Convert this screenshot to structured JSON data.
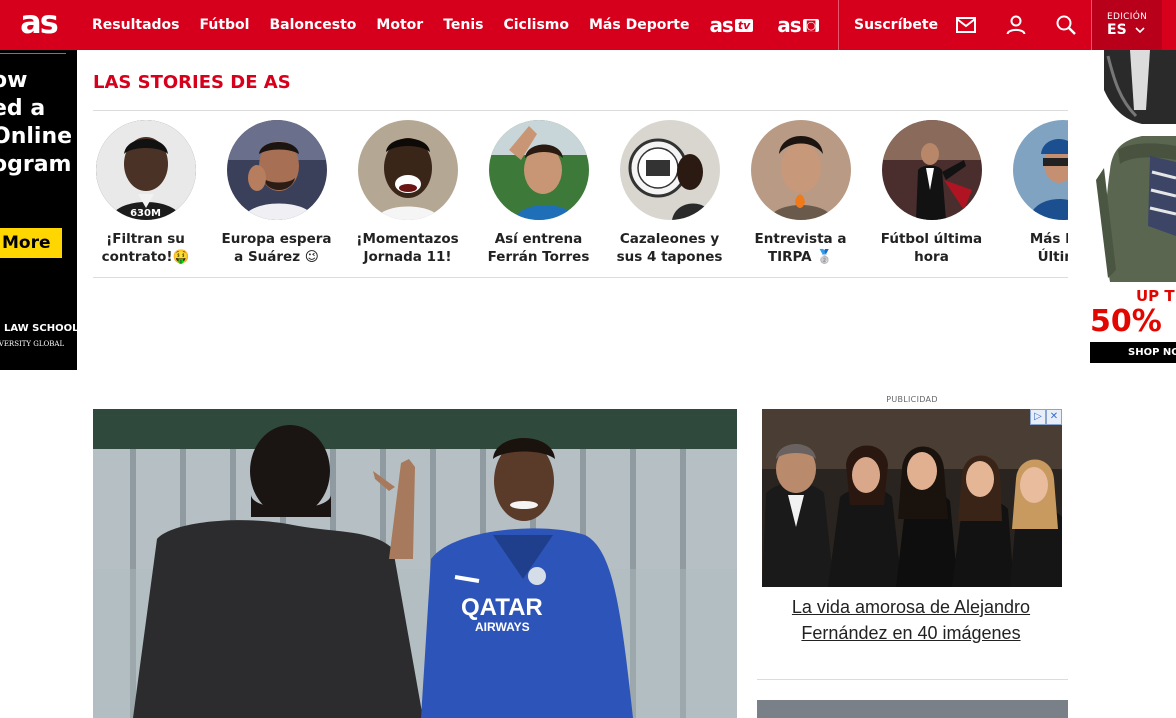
{
  "header": {
    "logo_text": "as",
    "nav": [
      "Resultados",
      "Fútbol",
      "Baloncesto",
      "Motor",
      "Tenis",
      "Ciclismo",
      "Más Deporte"
    ],
    "brands": [
      {
        "main": "as",
        "tag": "tv"
      },
      {
        "main": "as",
        "tag": "◙"
      }
    ],
    "subscribe_label": "Suscríbete",
    "icons": [
      "mail-icon",
      "user-icon",
      "search-icon"
    ],
    "edition_label": "EDICIÓN",
    "edition_value": "ES"
  },
  "left_ad": {
    "lines": [
      "ow",
      "ed a",
      "Online",
      "ogram"
    ],
    "button": "More",
    "school": "O LAW SCHOOL",
    "university": "IVERSITY GLOBAL"
  },
  "right_ad": {
    "up_text": "UP T",
    "percent": "50% ",
    "shop": "SHOP NO"
  },
  "stories": {
    "title": "LAS STORIES DE AS",
    "items": [
      {
        "line1": "¡Filtran su",
        "line2": "contrato!🤑",
        "views": "630M"
      },
      {
        "line1": "Europa espera",
        "line2": "a Suárez 😉",
        "views": ""
      },
      {
        "line1": "¡Momentazos",
        "line2": "Jornada 11!",
        "views": ""
      },
      {
        "line1": "Así entrena",
        "line2": "Ferrán Torres",
        "views": ""
      },
      {
        "line1": "Cazaleones y",
        "line2": "sus 4 tapones",
        "views": ""
      },
      {
        "line1": "Entrevista a",
        "line2": "TIRPA 🥈",
        "views": ""
      },
      {
        "line1": "Fútbol última",
        "line2": "hora",
        "views": ""
      },
      {
        "line1": "Más Dep",
        "line2": "Última",
        "views": ""
      }
    ]
  },
  "sidebar_ad": {
    "label": "PUBLICIDAD",
    "headline": "La vida amorosa de Alejandro Fernández en 40 imágenes",
    "badges": [
      "▷",
      "✕"
    ]
  },
  "colors": {
    "brand_red": "#d6001c",
    "edition_bg": "#b8001a",
    "ad_yellow": "#ffd600"
  }
}
